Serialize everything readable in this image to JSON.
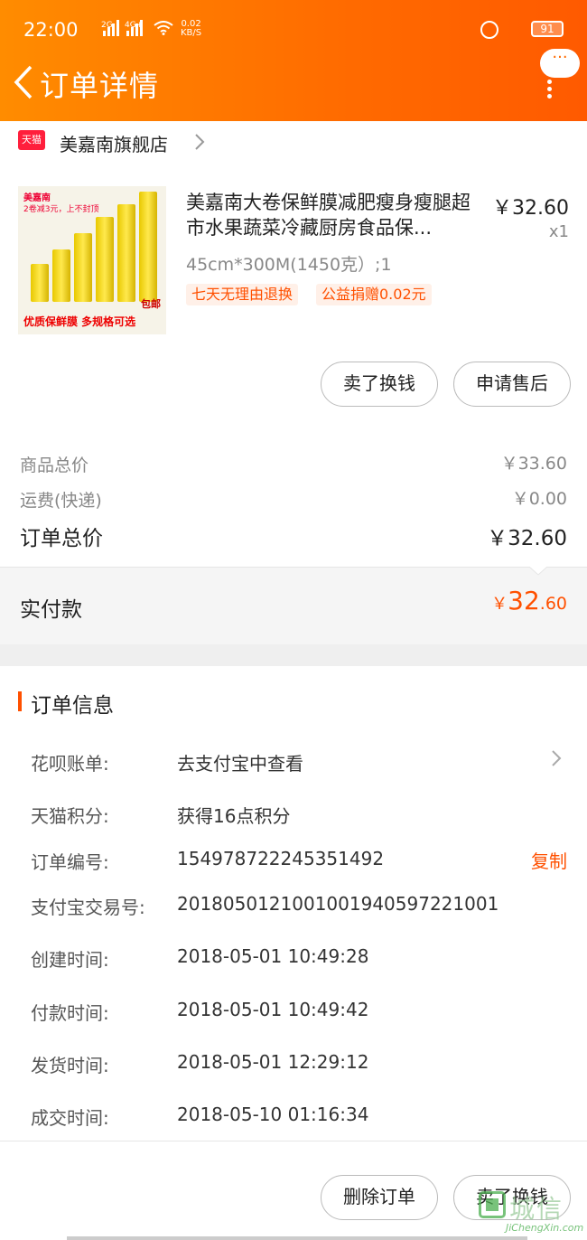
{
  "status": {
    "time": "22:00",
    "sig1": "2G",
    "sig2": "4G+",
    "speed_top": "0.02",
    "speed_bottom": "KB/S",
    "battery": "91"
  },
  "header": {
    "title": "订单详情",
    "more": "···"
  },
  "shop": {
    "badge": "天猫",
    "name": "美嘉南旗舰店"
  },
  "item": {
    "title": "美嘉南大卷保鲜膜减肥瘦身瘦腿超市水果蔬菜冷藏厨房食品保...",
    "price": "￥32.60",
    "qty": "x1",
    "spec": "45cm*300M(1450克）;1",
    "tags": [
      "七天无理由退换",
      "公益捐赠0.02元"
    ],
    "thumb": {
      "brand": "美嘉南",
      "promo": "2卷减3元，上不封顶",
      "label": "包邮",
      "slogan": "优质保鲜膜 多规格可选"
    }
  },
  "item_actions": {
    "sell": "卖了换钱",
    "after_sale": "申请售后"
  },
  "summary": {
    "goods_label": "商品总价",
    "goods_value": "￥33.60",
    "shipping_label": "运费(快递)",
    "shipping_value": "￥0.00",
    "total_label": "订单总价",
    "total_value": "￥32.60"
  },
  "paid": {
    "label": "实付款",
    "currency": "￥",
    "integer": "32",
    "decimal": ".60"
  },
  "order_info": {
    "title": "订单信息",
    "rows": [
      {
        "label": "花呗账单:",
        "value": "去支付宝中查看"
      },
      {
        "label": "天猫积分:",
        "value": "获得16点积分"
      },
      {
        "label": "订单编号:",
        "value": "154978722245351492"
      },
      {
        "label": "支付宝交易号:",
        "value": "2018050121001001940597221001"
      },
      {
        "label": "创建时间:",
        "value": "2018-05-01 10:49:28"
      },
      {
        "label": "付款时间:",
        "value": "2018-05-01 10:49:42"
      },
      {
        "label": "发货时间:",
        "value": "2018-05-01 12:29:12"
      },
      {
        "label": "成交时间:",
        "value": "2018-05-10 01:16:34"
      }
    ],
    "copy": "复制"
  },
  "footer": {
    "delete": "删除订单",
    "sell": "卖了换钱"
  },
  "watermark": {
    "cn": "城信",
    "en": "JiChengXin.com"
  },
  "colors": {
    "accent": "#ff5000",
    "header_start": "#ff8c00",
    "header_end": "#ff5a00",
    "tmall_red": "#ff1f3c"
  }
}
